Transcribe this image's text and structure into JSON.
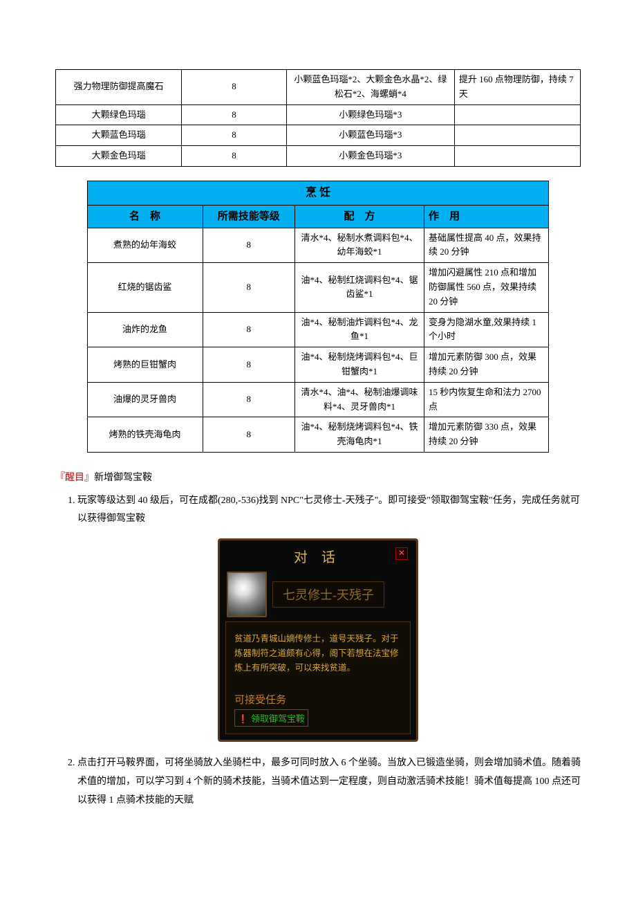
{
  "table1": {
    "rows": [
      {
        "name": "强力物理防御提高魔石",
        "level": "8",
        "recipe": "小颗蓝色玛瑙*2、大颗金色水晶*2、绿松石*2、海螺蛸*4",
        "effect": "提升 160 点物理防御，持续 7 天"
      },
      {
        "name": "大颗绿色玛瑙",
        "level": "8",
        "recipe": "小颗绿色玛瑙*3",
        "effect": ""
      },
      {
        "name": "大颗蓝色玛瑙",
        "level": "8",
        "recipe": "小颗蓝色玛瑙*3",
        "effect": ""
      },
      {
        "name": "大颗金色玛瑙",
        "level": "8",
        "recipe": "小颗金色玛瑙*3",
        "effect": ""
      }
    ]
  },
  "table2": {
    "title": "烹 饪",
    "headers": {
      "c1": "名　称",
      "c2": "所需技能等级",
      "c3": "配　方",
      "c4": "作　用"
    },
    "rows": [
      {
        "name": "煮熟的幼年海蛟",
        "level": "8",
        "recipe": "清水*4、秘制水煮调料包*4、幼年海蛟*1",
        "effect": "基础属性提高 40 点，效果持续 20 分钟"
      },
      {
        "name": "红烧的锯齿鲨",
        "level": "8",
        "recipe": "油*4、秘制红烧调料包*4、锯齿鲨*1",
        "effect": "增加闪避属性 210 点和增加防御属性 560 点，效果持续 20 分钟"
      },
      {
        "name": "油炸的龙鱼",
        "level": "8",
        "recipe": "油*4、秘制油炸调料包*4、龙鱼*1",
        "effect": "变身为隐湖水童,效果持续 1 个小时"
      },
      {
        "name": "烤熟的巨钳蟹肉",
        "level": "8",
        "recipe": "油*4、秘制烧烤调料包*4、巨钳蟹肉*1",
        "effect": "增加元素防御 300 点，效果持续 20 分钟"
      },
      {
        "name": "油爆的灵牙兽肉",
        "level": "8",
        "recipe": "清水*4、油*4、秘制油爆调味料*4、灵牙兽肉*1",
        "effect": "15 秒内恢复生命和法力 2700 点"
      },
      {
        "name": "烤熟的铁壳海龟肉",
        "level": "8",
        "recipe": "油*4、秘制烧烤调料包*4、铁壳海龟肉*1",
        "effect": "增加元素防御 330 点，效果持续 20 分钟"
      }
    ]
  },
  "section": {
    "label": "『醒目』",
    "title": "新增御驾宝鞍",
    "item1": "玩家等级达到 40 级后，可在成都(280,-536)找到 NPC\"七灵修士-天残子\"。即可接受\"领取御驾宝鞍\"任务，完成任务就可以获得御驾宝鞍",
    "item2": "点击打开马鞍界面，可将坐骑放入坐骑栏中，最多可同时放入 6 个坐骑。当放入已锻造坐骑，则会增加骑术值。随着骑术值的增加，可以学习到 4 个新的骑术技能，当骑术值达到一定程度，则自动激活骑术技能！骑术值每提高 100 点还可以获得 1 点骑术技能的天赋"
  },
  "dialog": {
    "title": "对话",
    "npc_name": "七灵修士-天残子",
    "text": "贫道乃青城山嫡传修士，道号天残子。对于炼器制符之道颇有心得，阁下若想在法宝修炼上有所突破，可以来找贫道。",
    "task_label": "可接受任务",
    "task_item": "领取御驾宝鞍"
  }
}
